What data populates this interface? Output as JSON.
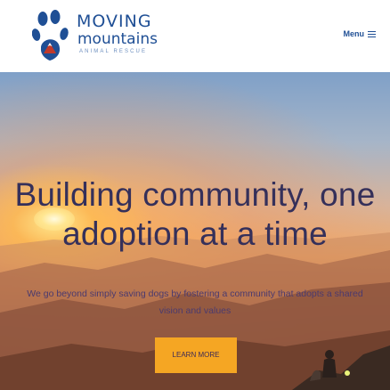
{
  "header": {
    "logo": {
      "line1": "MOVING",
      "line2": "mountains",
      "line3": "ANIMAL RESCUE"
    },
    "menu_label": "Menu"
  },
  "hero": {
    "title_line1": "Building community, one",
    "title_line2": "adoption at a time",
    "subtitle_line1": "We go beyond simply saving dogs by fostering a community that adopts a shared",
    "subtitle_line2": "vision and values",
    "cta_label": "LEARN MORE"
  },
  "colors": {
    "brand_blue": "#1f4f95",
    "cta_orange": "#f5a623",
    "title_purple": "#35305a"
  }
}
